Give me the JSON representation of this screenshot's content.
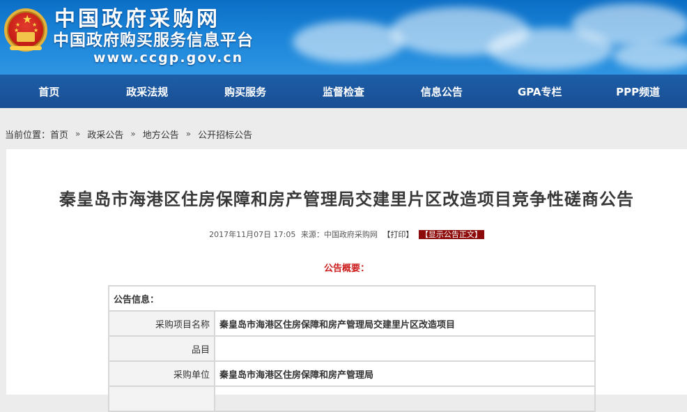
{
  "header": {
    "site_title": "中国政府采购网",
    "site_subtitle": "中国政府购买服务信息平台",
    "site_url": "www.ccgp.gov.cn",
    "emblem_icon": "national-emblem"
  },
  "nav": {
    "items": [
      "首页",
      "政采法规",
      "购买服务",
      "监督检查",
      "信息公告",
      "GPA专栏",
      "PPP频道"
    ]
  },
  "breadcrumb": {
    "prefix": "当前位置：",
    "items": [
      "首页",
      "政采公告",
      "地方公告",
      "公开招标公告"
    ],
    "separator": "»"
  },
  "article": {
    "title": "秦皇岛市海港区住房保障和房产管理局交建里片区改造项目竞争性磋商公告",
    "date": "2017年11月07日 17:05",
    "source_label": "来源：",
    "source": "中国政府采购网",
    "print_label": "【打印】",
    "show_text_label": "【显示公告正文】",
    "summary_heading": "公告概要："
  },
  "info_table": {
    "header": "公告信息：",
    "rows": [
      {
        "label": "采购项目名称",
        "value": "秦皇岛市海港区住房保障和房产管理局交建里片区改造项目"
      },
      {
        "label": "品目",
        "value": ""
      },
      {
        "label": "采购单位",
        "value": "秦皇岛市海港区住房保障和房产管理局"
      }
    ]
  },
  "colors": {
    "header_blue": "#1a84d8",
    "nav_blue": "#1a4e92",
    "accent_red": "#cc1c1c",
    "button_dark_red": "#8e0b0b"
  }
}
